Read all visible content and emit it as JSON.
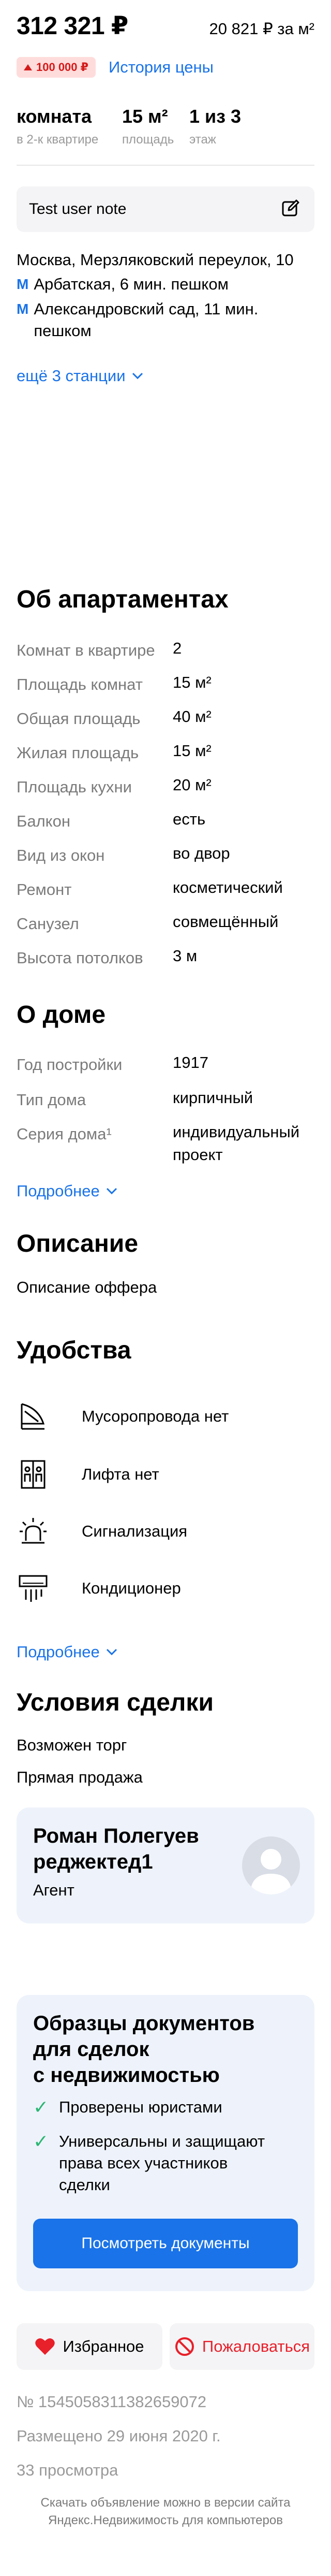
{
  "price": {
    "total": "312 321 ₽",
    "per_m2": "20 821 ₽ за м²",
    "change_badge": "100 000 ₽",
    "history_link": "История цены"
  },
  "params": [
    {
      "value": "комната",
      "label": "в 2-к квартире"
    },
    {
      "value": "15 м²",
      "label": "площадь"
    },
    {
      "value": "1 из 3",
      "label": "этаж"
    }
  ],
  "note": {
    "text": "Test user note"
  },
  "location": {
    "address": "Москва, Мерзляковский переулок, 10",
    "metro_symbol": "М",
    "metro": [
      {
        "line1": "Арбатская, 6 мин. пешком",
        "line2": ""
      },
      {
        "line1": "Александровский сад, 11 мин.",
        "line2": "пешком"
      }
    ],
    "more_stations": "ещё 3 станции"
  },
  "apartment": {
    "title": "Об апартаментах",
    "rows": [
      {
        "label": "Комнат в квартире",
        "value": "2"
      },
      {
        "label": "Площадь комнат",
        "value": "15 м²"
      },
      {
        "label": "Общая площадь",
        "value": "40 м²"
      },
      {
        "label": "Жилая площадь",
        "value": "15 м²"
      },
      {
        "label": "Площадь кухни",
        "value": "20 м²"
      },
      {
        "label": "Балкон",
        "value": "есть"
      },
      {
        "label": "Вид из окон",
        "value": "во двор"
      },
      {
        "label": "Ремонт",
        "value": "косметический"
      },
      {
        "label": "Санузел",
        "value": "совмещённый"
      },
      {
        "label": "Высота потолков",
        "value": "3 м"
      }
    ]
  },
  "house": {
    "title": "О доме",
    "rows": [
      {
        "label": "Год постройки",
        "value": "1917"
      },
      {
        "label": "Тип дома",
        "value": "кирпичный"
      },
      {
        "label": "Серия дома¹",
        "value": "индивидуальный",
        "value2": "проект"
      }
    ],
    "more": "Подробнее"
  },
  "description": {
    "title": "Описание",
    "text": "Описание оффера"
  },
  "amenities": {
    "title": "Удобства",
    "items": [
      {
        "label": "Мусоропровода нет",
        "icon": "garbage-chute-icon"
      },
      {
        "label": "Лифта нет",
        "icon": "elevator-icon"
      },
      {
        "label": "Сигнализация",
        "icon": "alarm-icon"
      },
      {
        "label": "Кондиционер",
        "icon": "air-conditioner-icon"
      }
    ],
    "more": "Подробнее"
  },
  "deal": {
    "title": "Условия сделки",
    "lines": [
      "Возможен торг",
      "Прямая продажа"
    ]
  },
  "agent": {
    "name_line1": "Роман Полегуев",
    "name_line2": "реджектед1",
    "role": "Агент"
  },
  "promo": {
    "title_lines": [
      "Образцы документов",
      "для сделок",
      "с недвижимостью"
    ],
    "checks": [
      {
        "lines": [
          "Проверены юристами"
        ]
      },
      {
        "lines": [
          "Универсальны и защищают",
          "права всех участников",
          "сделки"
        ]
      }
    ],
    "button": "Посмотреть документы"
  },
  "actions": {
    "favorite": "Избранное",
    "complain": "Пожаловаться"
  },
  "meta": {
    "id": "№ 1545058311382659072",
    "published": "Размещено 29 июня 2020 г.",
    "views": "33 просмотра"
  },
  "footer": {
    "line1": "Скачать объявление можно в версии сайта",
    "line2": "Яндекс.Недвижимость для компьютеров"
  },
  "colors": {
    "accent": "#1a73e8",
    "badge_bg": "#ffdcdc",
    "badge_fg": "#d41b1b",
    "check": "#2bb673",
    "card_bg": "#eef3fb"
  }
}
